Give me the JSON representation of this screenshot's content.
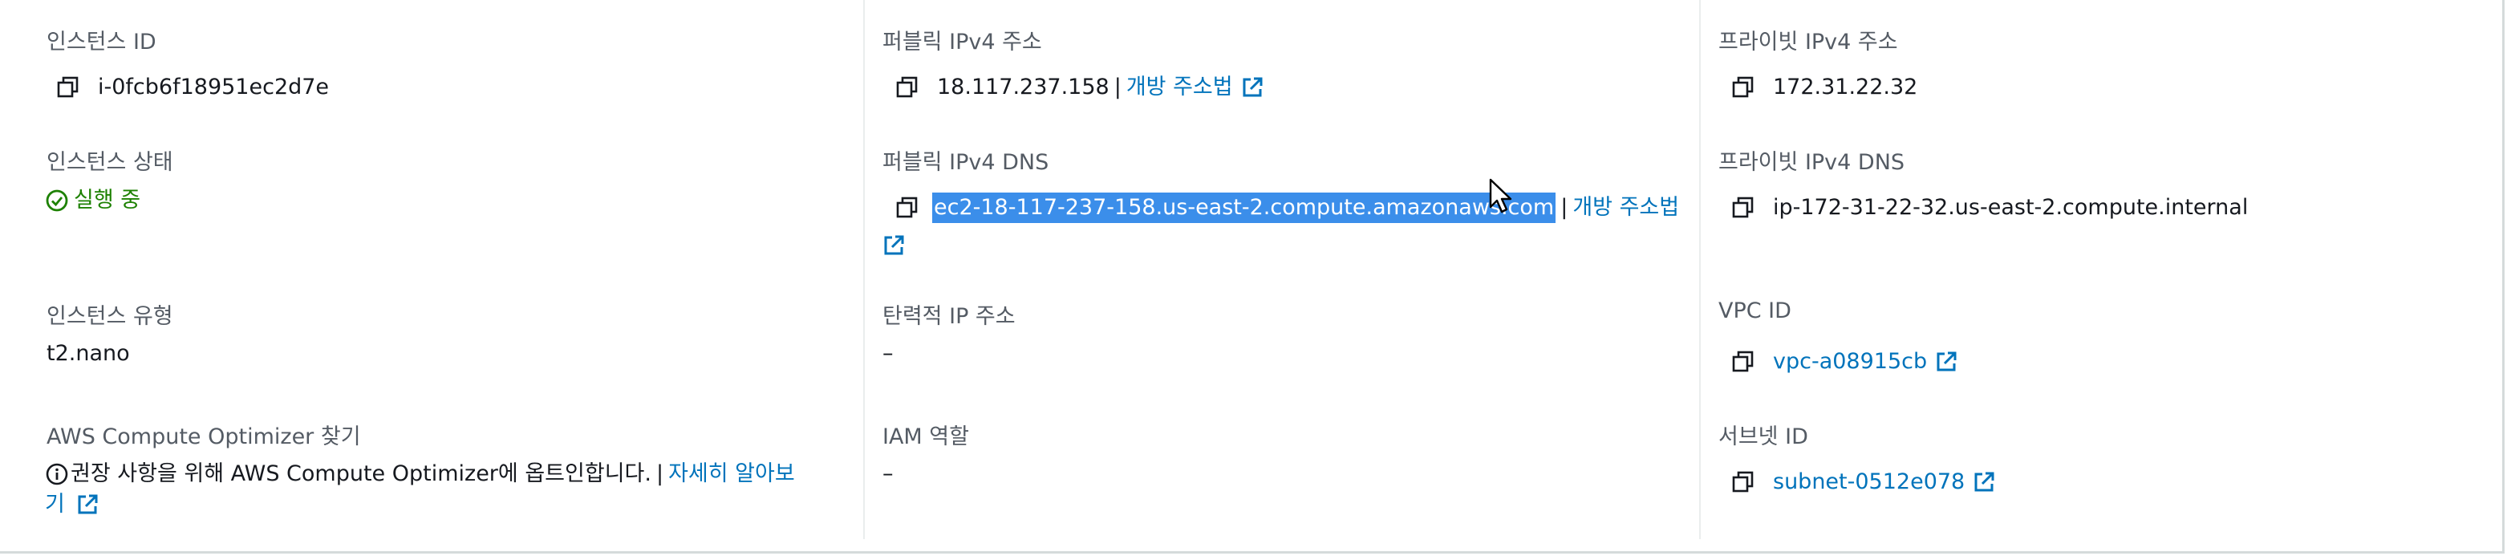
{
  "col1": {
    "instance_id": {
      "label": "인스턴스 ID",
      "value": "i-0fcb6f18951ec2d7e"
    },
    "instance_state": {
      "label": "인스턴스 상태",
      "value": "실행 중"
    },
    "instance_type": {
      "label": "인스턴스 유형",
      "value": "t2.nano"
    },
    "optimizer": {
      "label": "AWS Compute Optimizer 찾기",
      "text": "권장 사항을 위해 AWS Compute Optimizer에 옵트인합니다.",
      "separator": "|",
      "link_line1": "자세히 알아보",
      "link_line2": "기"
    }
  },
  "col2": {
    "public_ipv4": {
      "label": "퍼블릭 IPv4 주소",
      "value": "18.117.237.158",
      "separator": "|",
      "link": "개방 주소법"
    },
    "public_dns": {
      "label": "퍼블릭 IPv4 DNS",
      "value": "ec2-18-117-237-158.us-east-2.compute.amazonaws.com",
      "separator": "|",
      "link": "개방 주소법"
    },
    "elastic_ip": {
      "label": "탄력적 IP 주소",
      "value": "–"
    },
    "iam_role": {
      "label": "IAM 역할",
      "value": "–"
    }
  },
  "col3": {
    "private_ipv4": {
      "label": "프라이빗 IPv4 주소",
      "value": "172.31.22.32"
    },
    "private_dns": {
      "label": "프라이빗 IPv4 DNS",
      "value": "ip-172-31-22-32.us-east-2.compute.internal"
    },
    "vpc_id": {
      "label": "VPC ID",
      "value": "vpc-a08915cb"
    },
    "subnet_id": {
      "label": "서브넷 ID",
      "value": "subnet-0512e078"
    }
  },
  "colors": {
    "link": "#0073bb",
    "status_ok": "#1d8102",
    "selection": "#3b8eea",
    "label": "#545b64"
  },
  "icons": [
    "copy-icon",
    "external-link-icon",
    "check-circle-icon",
    "info-icon",
    "mouse-cursor-icon"
  ]
}
